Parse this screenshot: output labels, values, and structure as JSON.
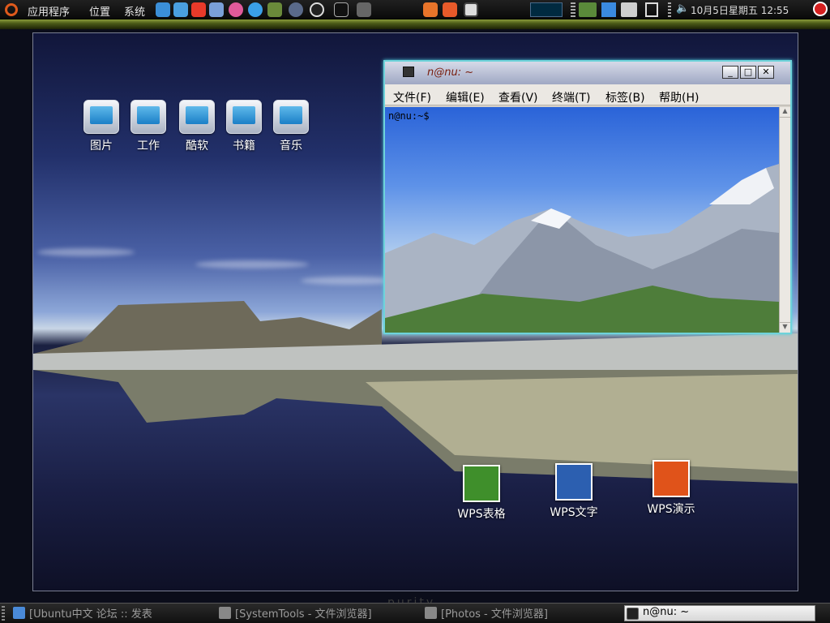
{
  "top_panel": {
    "menus": [
      "应用程序",
      "位置",
      "系统"
    ],
    "clock": "10月5日星期五 12:55"
  },
  "desktop": {
    "folders": [
      {
        "label": "图片"
      },
      {
        "label": "工作"
      },
      {
        "label": "酷软"
      },
      {
        "label": "书籍"
      },
      {
        "label": "音乐"
      }
    ],
    "wps_icons": [
      {
        "label": "WPS表格",
        "color": "#3f8f2b"
      },
      {
        "label": "WPS文字",
        "color": "#2c5fb0"
      },
      {
        "label": "WPS演示",
        "color": "#e0531a"
      }
    ],
    "watermark": "purity"
  },
  "terminal": {
    "title": "n@nu: ~",
    "menu": [
      "文件(F)",
      "编辑(E)",
      "查看(V)",
      "终端(T)",
      "标签(B)",
      "帮助(H)"
    ],
    "prompt": "n@nu:~$"
  },
  "taskbar": {
    "items": [
      {
        "label": "[Ubuntu中文 论坛 :: 发表"
      },
      {
        "label": "[SystemTools - 文件浏览器]"
      },
      {
        "label": "[Photos - 文件浏览器]"
      },
      {
        "label": "n@nu: ~"
      }
    ]
  },
  "colors": {
    "panel_accent": "#6b7a2a",
    "window_border": "#6ed3da",
    "power": "#d42020"
  }
}
